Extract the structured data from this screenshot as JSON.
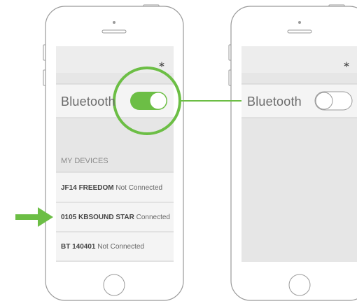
{
  "phones": [
    {
      "status_icon": "bluetooth-icon",
      "bluetooth_label": "Bluetooth",
      "toggle_state": "on",
      "section_label": "MY DEVICES",
      "devices": [
        {
          "name": "JF14 FREEDOM",
          "status": "Not Connected"
        },
        {
          "name": "0105 KBSOUND STAR",
          "status": "Connected"
        },
        {
          "name": "BT 140401",
          "status": "Not Connected"
        }
      ]
    },
    {
      "status_icon": "bluetooth-icon",
      "bluetooth_label": "Bluetooth",
      "toggle_state": "off"
    }
  ],
  "colors": {
    "accent": "#6cbe45",
    "phone_outline": "#9a9a9a",
    "screen_gray": "#e6e6e6",
    "cell_white": "#f4f4f4"
  },
  "annotations": {
    "highlight_circle": "around-toggle-on",
    "arrow_points_to": "connected-device"
  }
}
